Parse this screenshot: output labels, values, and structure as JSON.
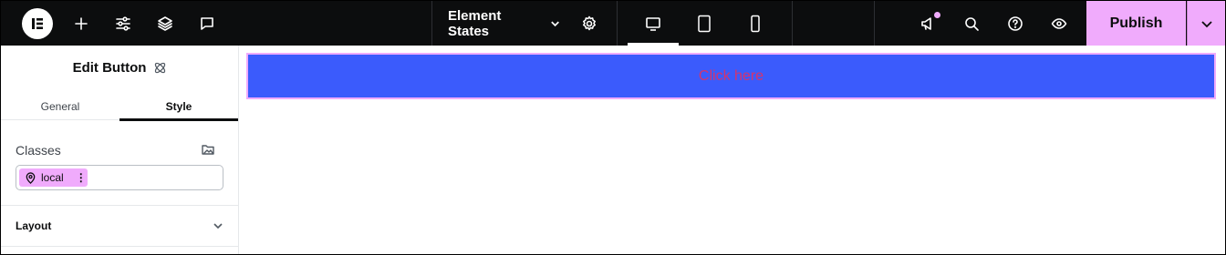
{
  "topbar": {
    "logo_icon": "elementor-logo-icon",
    "add_icon": "plus-icon",
    "settings_icon": "sliders-icon",
    "structure_icon": "layers-icon",
    "comments_icon": "comment-icon",
    "document_title": "Element States",
    "document_settings_icon": "gear-icon",
    "devices": [
      "desktop-icon",
      "tablet-icon",
      "mobile-icon"
    ],
    "active_device": "desktop",
    "notifications_icon": "megaphone-icon",
    "search_icon": "search-icon",
    "help_icon": "help-icon",
    "preview_icon": "eye-icon",
    "publish_label": "Publish",
    "accent_color": "#f0abfc"
  },
  "panel": {
    "title": "Edit Button",
    "tabs": [
      {
        "label": "General",
        "active": false
      },
      {
        "label": "Style",
        "active": true
      }
    ],
    "classes_label": "Classes",
    "class_chips": [
      {
        "label": "local"
      }
    ],
    "sections": [
      {
        "title": "Layout",
        "expanded": false
      }
    ]
  },
  "canvas": {
    "button_text": "Click here",
    "button_bg": "#3b5bfc",
    "button_text_color": "#d6336c"
  }
}
